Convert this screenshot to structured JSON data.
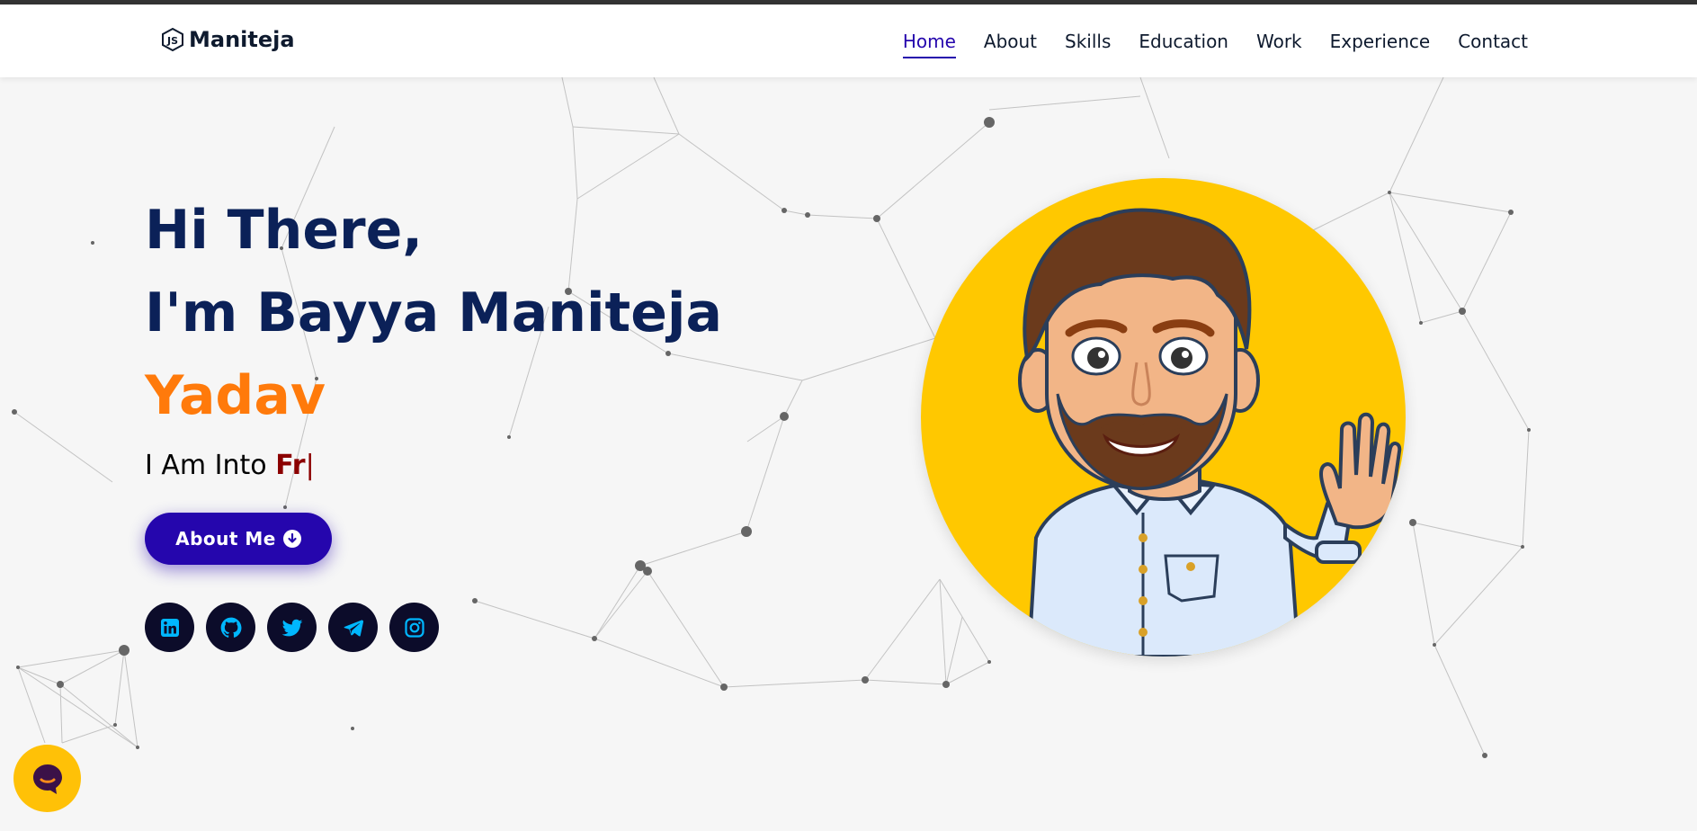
{
  "brand": {
    "name": "Maniteja",
    "logo_icon": "nodejs-icon"
  },
  "nav": {
    "items": [
      {
        "label": "Home",
        "active": true
      },
      {
        "label": "About",
        "active": false
      },
      {
        "label": "Skills",
        "active": false
      },
      {
        "label": "Education",
        "active": false
      },
      {
        "label": "Work",
        "active": false
      },
      {
        "label": "Experience",
        "active": false
      },
      {
        "label": "Contact",
        "active": false
      }
    ]
  },
  "hero": {
    "line1": "Hi There,",
    "line2": "I'm Bayya Maniteja",
    "line3": "Yadav",
    "typed_prefix": "I Am Into ",
    "typed_text": "Fr",
    "cursor": "|",
    "button_label": "About Me",
    "button_icon": "arrow-circle-down-icon",
    "avatar": "bitmoji-waving-avatar"
  },
  "socials": [
    {
      "name": "linkedin",
      "icon": "linkedin-icon"
    },
    {
      "name": "github",
      "icon": "github-icon"
    },
    {
      "name": "twitter",
      "icon": "twitter-icon"
    },
    {
      "name": "telegram",
      "icon": "telegram-icon"
    },
    {
      "name": "instagram",
      "icon": "instagram-icon"
    }
  ],
  "chat": {
    "icon": "chat-bubble-icon"
  },
  "colors": {
    "navy": "#0b2158",
    "orange": "#ff7a0b",
    "accent": "#2506ad",
    "typed": "#8b0000",
    "avatar_bg": "#ffc800",
    "social_bg": "#0c0c2a",
    "social_icon": "#00b7ff",
    "chat_bg": "#ffc107"
  }
}
